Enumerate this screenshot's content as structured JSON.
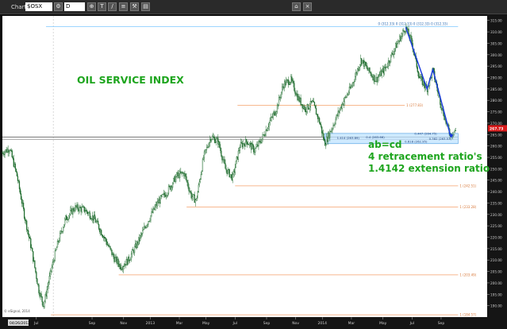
{
  "window": {
    "title": "Chart",
    "symbol": "$OSX",
    "interval": "D",
    "toolbar_icons": [
      "gear-icon",
      "magnify-icon",
      "text-icon",
      "line-icon",
      "settings-icon",
      "wrench-icon",
      "close-icon",
      "lock-icon"
    ]
  },
  "colors": {
    "background": "#ffffff",
    "candles": "#1d6b2c",
    "title_text": "#1ea51e",
    "fib_lines": "#f5a06a",
    "abcd_arrow": "#1a3adf",
    "target_zone": "#bfe3ff",
    "price_marker": "#d81b1b",
    "top_line": "#7ec8ff"
  },
  "chart_data": {
    "type": "candlestick",
    "title": "OIL SERVICE INDEX",
    "annotations": [
      "ab=cd",
      "4 retracement ratio's",
      "1.4142 extension ratio"
    ],
    "ylim": [
      185,
      317
    ],
    "y_ticks": [
      "190.00",
      "195.00",
      "200.00",
      "205.00",
      "210.00",
      "215.00",
      "220.00",
      "225.00",
      "230.00",
      "235.00",
      "240.00",
      "245.00",
      "250.00",
      "255.00",
      "260.00",
      "265.00",
      "270.00",
      "275.00",
      "280.00",
      "285.00",
      "290.00",
      "295.00",
      "300.00",
      "305.00",
      "310.00",
      "315.00"
    ],
    "x_ticks": [
      {
        "label": "Jul",
        "pos": 0.07
      },
      {
        "label": "Sep",
        "pos": 0.185
      },
      {
        "label": "Nov",
        "pos": 0.25
      },
      {
        "label": "2013",
        "pos": 0.305
      },
      {
        "label": "Mar",
        "pos": 0.365
      },
      {
        "label": "May",
        "pos": 0.42
      },
      {
        "label": "Jul",
        "pos": 0.48
      },
      {
        "label": "Sep",
        "pos": 0.545
      },
      {
        "label": "Nov",
        "pos": 0.605
      },
      {
        "label": "2014",
        "pos": 0.66
      },
      {
        "label": "Mar",
        "pos": 0.72
      },
      {
        "label": "May",
        "pos": 0.785
      },
      {
        "label": "Jul",
        "pos": 0.845
      },
      {
        "label": "Sep",
        "pos": 0.905
      }
    ],
    "date_label": "04/26/2012",
    "current_price_label": "267.73",
    "copyright": "© eSignal, 2014",
    "top_levels_label": "0 (312.33)  0 (312.33)  0 (312.33)  0 (312.33)",
    "fib_levels": [
      {
        "label": "1 (277.83)",
        "price": 277.83,
        "x_start": 0.485,
        "x_end": 0.83
      },
      {
        "label": "1 (242.51)",
        "price": 242.51,
        "x_start": 0.48,
        "x_end": 0.94
      },
      {
        "label": "1 (233.28)",
        "price": 233.28,
        "x_start": 0.38,
        "x_end": 0.94
      },
      {
        "label": "1 (203.49)",
        "price": 203.49,
        "x_start": 0.24,
        "x_end": 0.94
      },
      {
        "label": "1 (184.57)",
        "price": 186.0,
        "x_start": 0.1,
        "x_end": 0.94
      }
    ],
    "target_zone": {
      "price_low": 261.0,
      "price_high": 265.5,
      "x_start": 0.665,
      "x_end": 0.94,
      "labels": [
        "0.447 (264.75)",
        "1.414 (263.89)",
        "0.4 (263.66)",
        "0.382 (263.53)",
        "0.618 (262.95)"
      ]
    },
    "abcd": {
      "x": [
        0.832,
        0.876,
        0.888,
        0.925
      ],
      "y": [
        312.0,
        285.0,
        293.5,
        263.9
      ]
    },
    "price_path": [
      {
        "x": 0.0,
        "y": 257
      },
      {
        "x": 0.015,
        "y": 259
      },
      {
        "x": 0.03,
        "y": 247
      },
      {
        "x": 0.045,
        "y": 230
      },
      {
        "x": 0.06,
        "y": 215
      },
      {
        "x": 0.075,
        "y": 197
      },
      {
        "x": 0.085,
        "y": 190
      },
      {
        "x": 0.1,
        "y": 205
      },
      {
        "x": 0.115,
        "y": 218
      },
      {
        "x": 0.13,
        "y": 228
      },
      {
        "x": 0.15,
        "y": 233
      },
      {
        "x": 0.17,
        "y": 232
      },
      {
        "x": 0.19,
        "y": 228
      },
      {
        "x": 0.21,
        "y": 220
      },
      {
        "x": 0.23,
        "y": 211
      },
      {
        "x": 0.245,
        "y": 207
      },
      {
        "x": 0.26,
        "y": 210
      },
      {
        "x": 0.28,
        "y": 218
      },
      {
        "x": 0.3,
        "y": 227
      },
      {
        "x": 0.32,
        "y": 235
      },
      {
        "x": 0.34,
        "y": 240
      },
      {
        "x": 0.36,
        "y": 247
      },
      {
        "x": 0.375,
        "y": 248
      },
      {
        "x": 0.39,
        "y": 238
      },
      {
        "x": 0.4,
        "y": 236
      },
      {
        "x": 0.415,
        "y": 255
      },
      {
        "x": 0.43,
        "y": 264
      },
      {
        "x": 0.445,
        "y": 262
      },
      {
        "x": 0.46,
        "y": 250
      },
      {
        "x": 0.475,
        "y": 246
      },
      {
        "x": 0.49,
        "y": 260
      },
      {
        "x": 0.505,
        "y": 262
      },
      {
        "x": 0.52,
        "y": 258
      },
      {
        "x": 0.535,
        "y": 263
      },
      {
        "x": 0.55,
        "y": 270
      },
      {
        "x": 0.565,
        "y": 276
      },
      {
        "x": 0.58,
        "y": 287
      },
      {
        "x": 0.595,
        "y": 289
      },
      {
        "x": 0.61,
        "y": 281
      },
      {
        "x": 0.625,
        "y": 276
      },
      {
        "x": 0.64,
        "y": 279
      },
      {
        "x": 0.655,
        "y": 270
      },
      {
        "x": 0.665,
        "y": 261
      },
      {
        "x": 0.68,
        "y": 268
      },
      {
        "x": 0.7,
        "y": 278
      },
      {
        "x": 0.72,
        "y": 286
      },
      {
        "x": 0.74,
        "y": 298
      },
      {
        "x": 0.755,
        "y": 293
      },
      {
        "x": 0.77,
        "y": 289
      },
      {
        "x": 0.79,
        "y": 294
      },
      {
        "x": 0.81,
        "y": 303
      },
      {
        "x": 0.832,
        "y": 312
      },
      {
        "x": 0.845,
        "y": 305
      },
      {
        "x": 0.86,
        "y": 290
      },
      {
        "x": 0.876,
        "y": 285
      },
      {
        "x": 0.888,
        "y": 293
      },
      {
        "x": 0.905,
        "y": 278
      },
      {
        "x": 0.918,
        "y": 268
      },
      {
        "x": 0.925,
        "y": 265
      },
      {
        "x": 0.935,
        "y": 267
      }
    ]
  }
}
